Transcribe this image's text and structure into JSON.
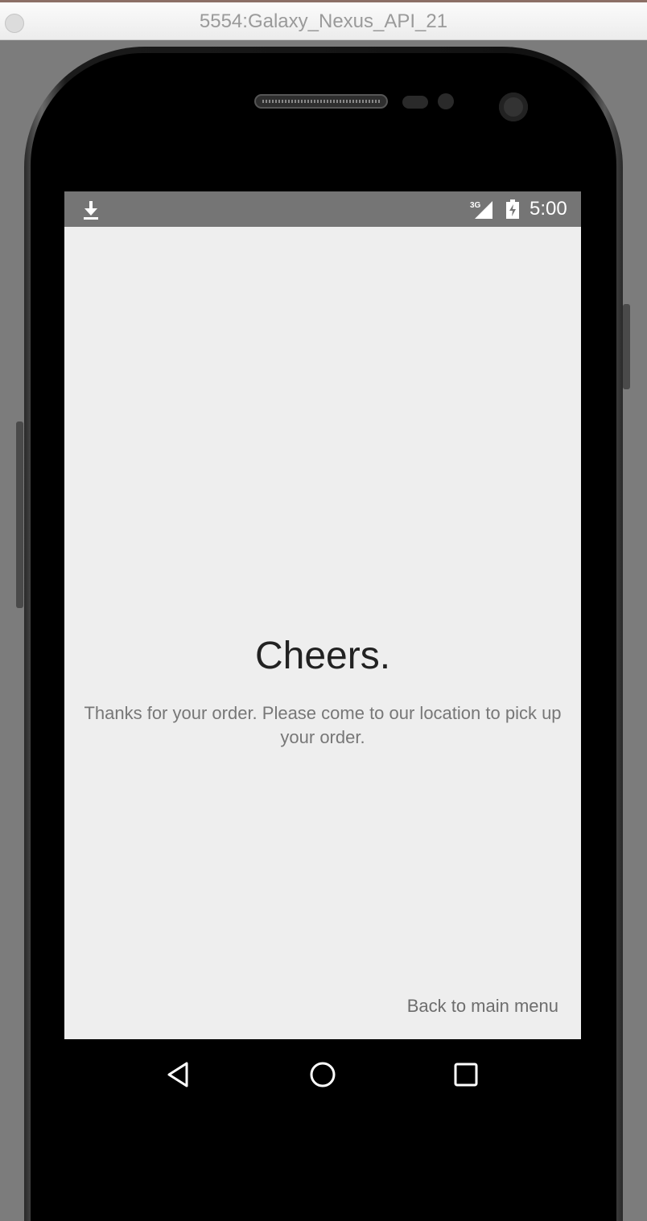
{
  "window": {
    "title": "5554:Galaxy_Nexus_API_21"
  },
  "statusbar": {
    "time": "5:00",
    "network": "3G",
    "icons": [
      "download-icon",
      "signal-icon",
      "battery-icon"
    ]
  },
  "content": {
    "heading": "Cheers.",
    "message": "Thanks for your order. Please come to our location to pick up your order.",
    "back_button_label": "Back to main menu"
  },
  "navbar": {
    "buttons": [
      "back-icon",
      "home-icon",
      "recents-icon"
    ]
  },
  "colors": {
    "statusbar": "#757575",
    "screen_background": "#eeeeee",
    "heading_text": "#222222",
    "body_text": "#777777"
  }
}
